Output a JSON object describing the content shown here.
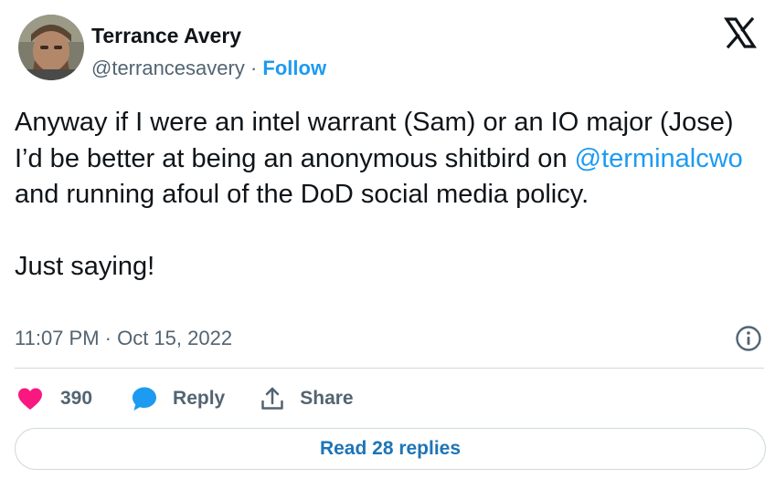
{
  "author": {
    "name": "Terrance Avery",
    "handle": "@terrancesavery",
    "separator": " · ",
    "follow_label": "Follow"
  },
  "tweet": {
    "text_part1": "Anyway if I were an intel warrant (Sam) or an IO major (Jose) I’d be better at being an anonymous shitbird on ",
    "mention": "@terminalcwo",
    "text_part2": " and running afoul of the DoD social media policy.\n\nJust saying!"
  },
  "timestamp": "11:07 PM · Oct 15, 2022",
  "actions": {
    "like_count": "390",
    "reply_label": "Reply",
    "share_label": "Share"
  },
  "read_replies_label": "Read 28 replies",
  "colors": {
    "accent": "#1d9bf0",
    "like": "#f91880",
    "text": "#0f1419",
    "muted": "#536471"
  },
  "icons": [
    "x-logo-icon",
    "info-icon",
    "heart-icon",
    "reply-bubble-icon",
    "share-icon"
  ]
}
